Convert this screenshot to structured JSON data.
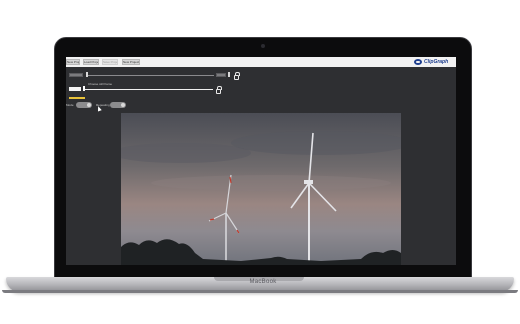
{
  "laptop": {
    "brand_label": "MacBook"
  },
  "app": {
    "menu": {
      "buttons": [
        {
          "label": "New Project",
          "enabled": true
        },
        {
          "label": "Load Project",
          "enabled": true
        },
        {
          "label": "Save Project",
          "enabled": false
        },
        {
          "label": "New Project",
          "enabled": true
        }
      ],
      "logo_text": "ClipGraph"
    },
    "controls": {
      "still_frame_label": "Choose still frame",
      "mode_label": "Mode",
      "repeating_label": "Repeating"
    }
  },
  "colors": {
    "screen_bg": "#2e2f32",
    "menubar_bg": "#f2f2f2",
    "accent_yellow": "#e8c23a",
    "logo_blue": "#1f3f8f"
  }
}
